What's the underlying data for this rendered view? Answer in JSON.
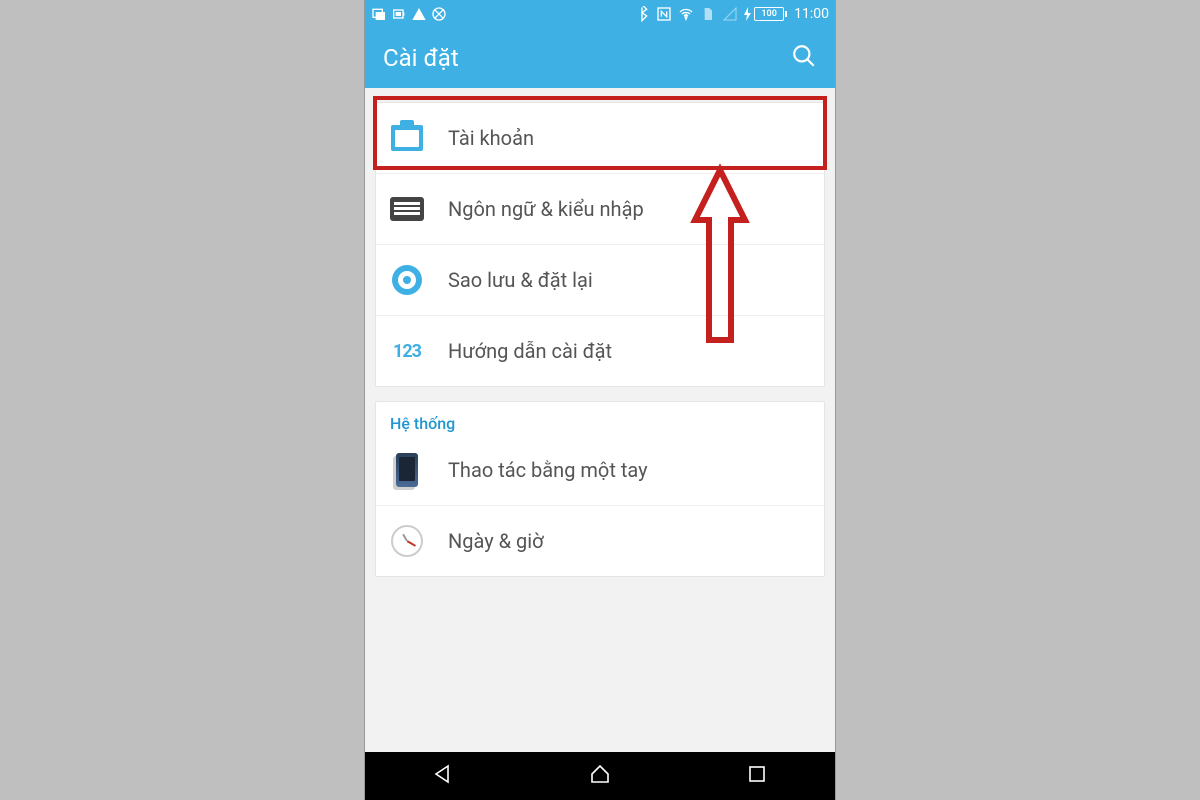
{
  "status_bar": {
    "battery_pct": "100",
    "clock": "11:00"
  },
  "app_bar": {
    "title": "Cài đặt"
  },
  "personal_section": {
    "items": [
      {
        "label": "Tài khoản"
      },
      {
        "label": "Ngôn ngữ & kiểu nhập"
      },
      {
        "label": "Sao lưu & đặt lại"
      },
      {
        "label": "Hướng dẫn cài đặt"
      }
    ]
  },
  "system_section": {
    "header": "Hệ thống",
    "items": [
      {
        "label": "Thao tác bằng một tay"
      },
      {
        "label": "Ngày & giờ"
      }
    ]
  }
}
